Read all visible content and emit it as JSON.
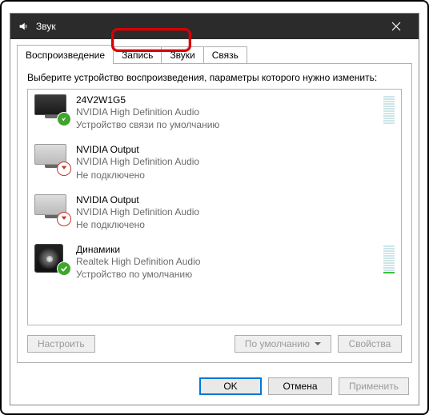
{
  "title": "Звук",
  "tabs": {
    "playback": "Воспроизведение",
    "recording": "Запись",
    "sounds": "Звуки",
    "communications": "Связь"
  },
  "description": "Выберите устройство воспроизведения, параметры которого нужно изменить:",
  "devices": [
    {
      "name": "24V2W1G5",
      "driver": "NVIDIA High Definition Audio",
      "status": "Устройство связи по умолчанию"
    },
    {
      "name": "NVIDIA Output",
      "driver": "NVIDIA High Definition Audio",
      "status": "Не подключено"
    },
    {
      "name": "NVIDIA Output",
      "driver": "NVIDIA High Definition Audio",
      "status": "Не подключено"
    },
    {
      "name": "Динамики",
      "driver": "Realtek High Definition Audio",
      "status": "Устройство по умолчанию"
    }
  ],
  "buttons": {
    "configure": "Настроить",
    "default": "По умолчанию",
    "properties": "Свойства",
    "ok": "OK",
    "cancel": "Отмена",
    "apply": "Применить"
  }
}
